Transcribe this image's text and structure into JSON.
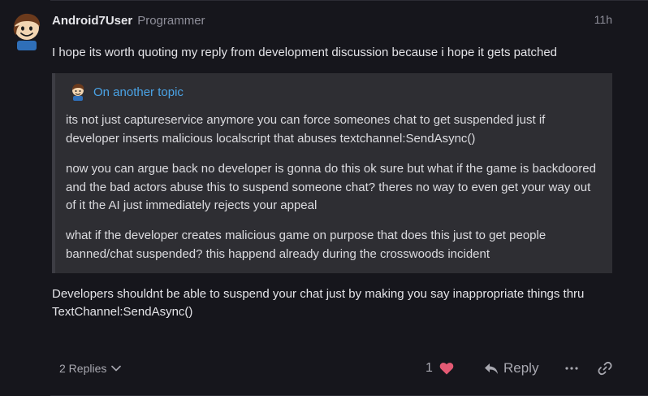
{
  "post": {
    "username": "Android7User",
    "user_title": "Programmer",
    "date": "11h",
    "intro": "I hope its worth quoting my reply from development discussion because i hope it gets patched",
    "quote": {
      "topic": "On another topic",
      "paragraphs": [
        "its not just captureservice anymore you can force someones chat to get suspended just if developer inserts malicious localscript that abuses textchannel:SendAsync()",
        "now you can argue back no developer is gonna do this ok sure but what if the game is backdoored and the bad actors abuse this to suspend someone chat? theres no way to even get your way out of it the AI just immediately rejects your appeal",
        "what if the developer creates malicious game on purpose that does this just to get people banned/chat suspended? this happend already during the crosswoods incident"
      ]
    },
    "closing": "Developers shouldnt be able to suspend your chat just by making you say inappropriate things thru TextChannel:SendAsync()"
  },
  "controls": {
    "replies_label": "2 Replies",
    "like_count": "1",
    "reply_label": "Reply"
  },
  "icons": {
    "avatar": "roblox-noob-avatar",
    "replies_toggle": "chevron-down-icon",
    "like": "heart-icon",
    "reply": "reply-arrow-icon",
    "more": "ellipsis-icon",
    "share": "link-icon"
  },
  "colors": {
    "background": "#16161c",
    "quote_background": "#2e2e33",
    "link": "#4aa3e6",
    "heart": "#e45a74",
    "muted": "#8f8f9a"
  }
}
